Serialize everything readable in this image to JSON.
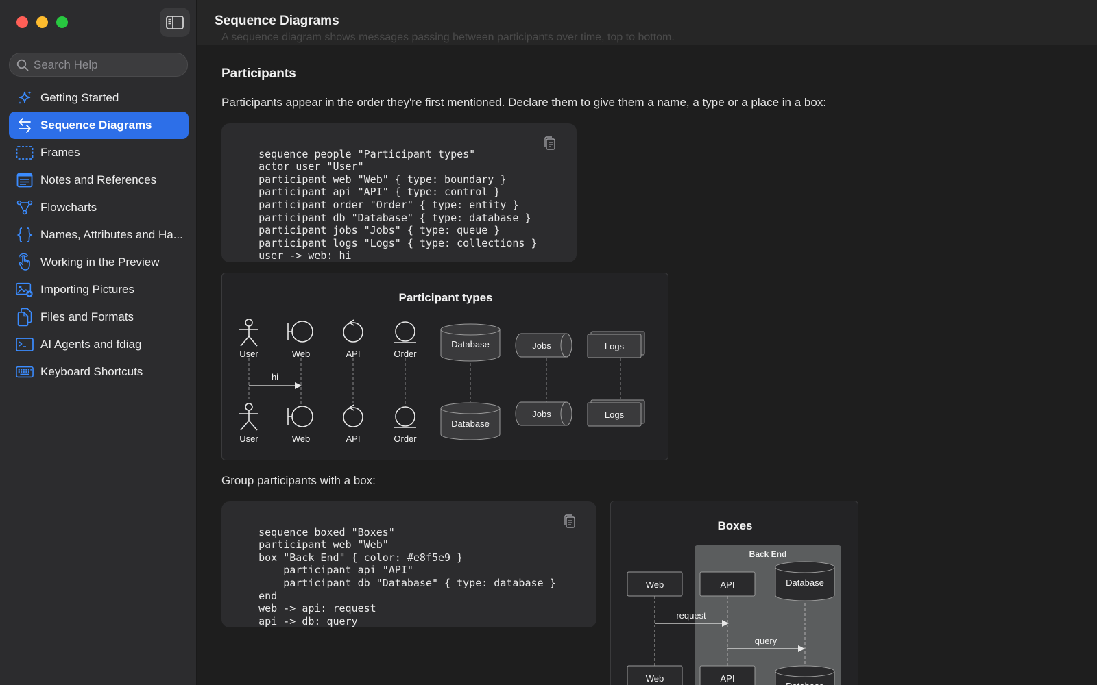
{
  "sidebar": {
    "search_placeholder": "Search Help",
    "items": [
      {
        "label": "Getting Started",
        "icon": "sparkles-icon"
      },
      {
        "label": "Sequence Diagrams",
        "icon": "arrows-left-right-icon",
        "active": true
      },
      {
        "label": "Frames",
        "icon": "dashed-rectangle-icon"
      },
      {
        "label": "Notes and References",
        "icon": "note-icon"
      },
      {
        "label": "Flowcharts",
        "icon": "flowchart-icon"
      },
      {
        "label": "Names, Attributes and Ha...",
        "icon": "braces-icon"
      },
      {
        "label": "Working in the Preview",
        "icon": "hand-pointer-icon"
      },
      {
        "label": "Importing Pictures",
        "icon": "photo-add-icon"
      },
      {
        "label": "Files and Formats",
        "icon": "documents-icon"
      },
      {
        "label": "AI Agents and fdiag",
        "icon": "terminal-icon"
      },
      {
        "label": "Keyboard Shortcuts",
        "icon": "keyboard-icon"
      }
    ]
  },
  "page": {
    "title": "Sequence Diagrams",
    "intro": "A sequence diagram shows messages passing between participants over time, top to bottom.",
    "section_title": "Participants",
    "paragraph1": "Participants appear in the order they're first mentioned. Declare them to give them a name, a type or a place in a box:",
    "code1": "sequence people \"Participant types\"\n    actor user \"User\"\n    participant web \"Web\" { type: boundary }\n    participant api \"API\" { type: control }\n    participant order \"Order\" { type: entity }\n    participant db \"Database\" { type: database }\n    participant jobs \"Jobs\" { type: queue }\n    participant logs \"Logs\" { type: collections }\n    user -> web: hi",
    "paragraph2": "Group participants with a box:",
    "code2": "sequence boxed \"Boxes\"\n    participant web \"Web\"\n    box \"Back End\" { color: #e8f5e9 }\n        participant api \"API\"\n        participant db \"Database\" { type: database }\n    end\n    web -> api: request\n    api -> db: query"
  },
  "diagram1": {
    "title": "Participant types",
    "participants": [
      "User",
      "Web",
      "API",
      "Order",
      "Database",
      "Jobs",
      "Logs"
    ],
    "message": "hi"
  },
  "diagram2": {
    "title": "Boxes",
    "box_label": "Back End",
    "participants": [
      "Web",
      "API",
      "Database"
    ],
    "messages": [
      "request",
      "query"
    ]
  },
  "colors": {
    "accent": "#2d6fe8",
    "icon_blue": "#3b8cff",
    "box_fill": "#5b5d5e"
  }
}
